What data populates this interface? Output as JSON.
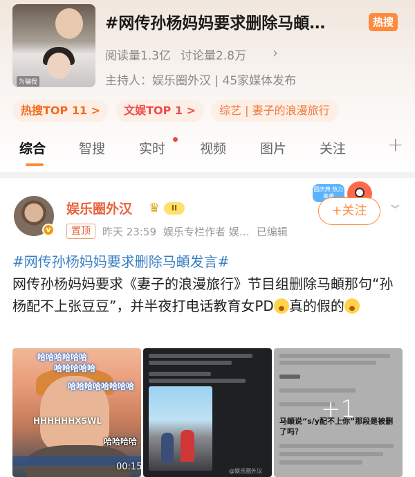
{
  "topic": {
    "title": "#网传孙杨妈妈要求删除马頔…",
    "hot_badge": "热搜",
    "reads": "阅读量1.3亿",
    "discussions": "讨论量2.8万",
    "host": "主持人：娱乐圈外汉 | 45家媒体发布",
    "cover_tag": "为骗我"
  },
  "chips": [
    {
      "label": "热搜TOP 11 >"
    },
    {
      "label": "文娱TOP 1 >"
    },
    {
      "label": "综艺 | 妻子的浪漫旅行"
    }
  ],
  "tabs": [
    {
      "label": "综合",
      "active": true
    },
    {
      "label": "智搜"
    },
    {
      "label": "实时"
    },
    {
      "label": "视频"
    },
    {
      "label": "图片"
    },
    {
      "label": "关注"
    }
  ],
  "post": {
    "author": "娱乐圈外汉",
    "level": "II",
    "pin_label": "置顶",
    "time": "昨天 23:59",
    "source": "娱乐专栏作者 娱…",
    "edited": "已编辑",
    "follow_label": "+关注",
    "promo_text": "圆庆典 热力来袭",
    "hashtag": "#网传孙杨妈妈要求删除马頔发言#",
    "text_a": "网传孙杨妈妈要求《妻子的浪漫旅行》节目组删除马頔那句“孙杨配不上张豆豆”，并半夜打电话教育女PD",
    "text_b": "真的假的"
  },
  "images": {
    "thumb1": {
      "laugh1": "哈哈哈哈哈哈",
      "laugh2": "哈哈哈哈哈",
      "laugh3": "哈哈哈哈哈哈哈哈",
      "hhh": "HHHHHHXSWL",
      "laugh4": "哈哈哈哈",
      "duration": "00:15"
    },
    "thumb2": {
      "watermark": "@娱乐圈外汉"
    },
    "thumb3": {
      "question": "马頔说“s/y配不上你”那段是被删了吗？",
      "more_count": "+1"
    }
  },
  "colors": {
    "accent": "#ff8a3d",
    "author": "#e8623a",
    "link": "#3a7fc4",
    "hot": "#ff8a3d"
  }
}
